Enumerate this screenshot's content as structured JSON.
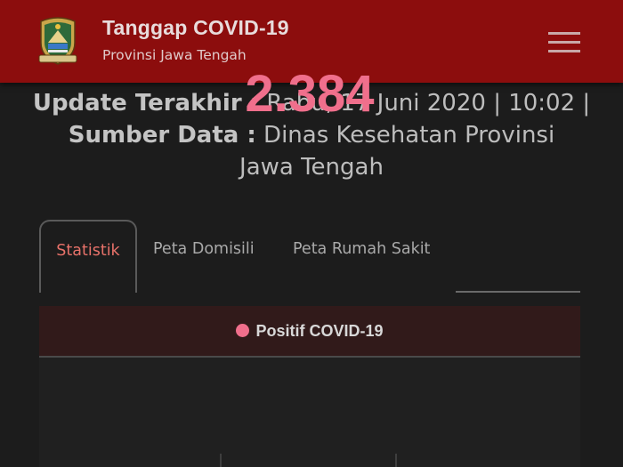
{
  "appbar": {
    "title": "Tanggap COVID-19",
    "subtitle": "Provinsi Jawa Tengah",
    "background": "#8c0d0d"
  },
  "update": {
    "last_update_label": "Update Terakhir :",
    "last_update_value": "Rabu, 17 Juni 2020 | 10:02 |",
    "source_label": "Sumber Data :",
    "source_value_1": "Dinas Kesehatan Provinsi",
    "source_value_2": "Jawa Tengah"
  },
  "tabs": [
    {
      "label": "Statistik",
      "active": true
    },
    {
      "label": "Peta Domisili",
      "active": false
    },
    {
      "label": "Peta Rumah Sakit",
      "active": false
    }
  ],
  "card": {
    "title": "Positif COVID-19",
    "value": "2.384",
    "accent": "#f06f8c"
  },
  "icons": {
    "logo": "jawa-tengah-emblem-icon",
    "menu": "hamburger-menu-icon"
  }
}
